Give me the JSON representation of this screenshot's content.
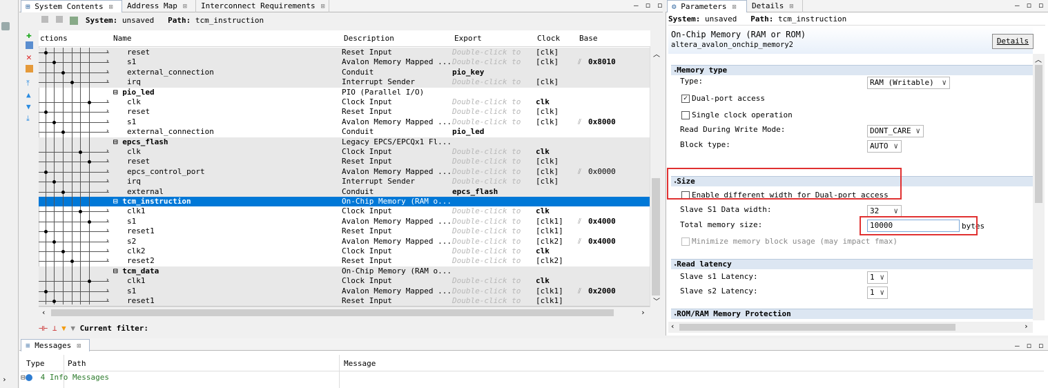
{
  "left_tabs": [
    "System Contents",
    "Address Map",
    "Interconnect Requirements"
  ],
  "right_tabs": [
    "Parameters",
    "Details"
  ],
  "win_ctl": "– ◻ ◻",
  "system_bar": {
    "label": "System:",
    "value": "unsaved",
    "path_label": "Path:",
    "path": "tcm_instruction"
  },
  "columns": {
    "connections": "ctions",
    "name": "Name",
    "description": "Description",
    "export": "Export",
    "clock": "Clock",
    "base": "Base"
  },
  "double_click": "Double-click to",
  "rows": [
    {
      "name": "reset",
      "desc": "Reset Input",
      "export": "",
      "clock": "[clk]",
      "base": ""
    },
    {
      "name": "s1",
      "desc": "Avalon Memory Mapped ...",
      "export": "",
      "clock": "[clk]",
      "base": "0x8010"
    },
    {
      "name": "external_connection",
      "desc": "Conduit",
      "export": "pio_key",
      "clock": "",
      "base": ""
    },
    {
      "name": "irq",
      "desc": "Interrupt Sender",
      "export": "",
      "clock": "[clk]",
      "base": ""
    },
    {
      "name": "⊟ pio_led",
      "desc": "PIO (Parallel I/O)",
      "export": "",
      "clock": "",
      "base": ""
    },
    {
      "name": "clk",
      "desc": "Clock Input",
      "export": "",
      "clock": "clk",
      "base": ""
    },
    {
      "name": "reset",
      "desc": "Reset Input",
      "export": "",
      "clock": "[clk]",
      "base": ""
    },
    {
      "name": "s1",
      "desc": "Avalon Memory Mapped ...",
      "export": "",
      "clock": "[clk]",
      "base": "0x8000"
    },
    {
      "name": "external_connection",
      "desc": "Conduit",
      "export": "pio_led",
      "clock": "",
      "base": ""
    },
    {
      "name": "⊟ epcs_flash",
      "desc": "Legacy EPCS/EPCQx1 Fl...",
      "export": "",
      "clock": "",
      "base": ""
    },
    {
      "name": "clk",
      "desc": "Clock Input",
      "export": "",
      "clock": "clk",
      "base": ""
    },
    {
      "name": "reset",
      "desc": "Reset Input",
      "export": "",
      "clock": "[clk]",
      "base": ""
    },
    {
      "name": "epcs_control_port",
      "desc": "Avalon Memory Mapped ...",
      "export": "",
      "clock": "[clk]",
      "base": "0x0000"
    },
    {
      "name": "irq",
      "desc": "Interrupt Sender",
      "export": "",
      "clock": "[clk]",
      "base": ""
    },
    {
      "name": "external",
      "desc": "Conduit",
      "export": "epcs_flash",
      "clock": "",
      "base": ""
    },
    {
      "name": "⊟ tcm_instruction",
      "desc": "On-Chip Memory (RAM o...",
      "export": "",
      "clock": "",
      "base": ""
    },
    {
      "name": "clk1",
      "desc": "Clock Input",
      "export": "",
      "clock": "clk",
      "base": ""
    },
    {
      "name": "s1",
      "desc": "Avalon Memory Mapped ...",
      "export": "",
      "clock": "[clk1]",
      "base": "0x4000"
    },
    {
      "name": "reset1",
      "desc": "Reset Input",
      "export": "",
      "clock": "[clk1]",
      "base": ""
    },
    {
      "name": "s2",
      "desc": "Avalon Memory Mapped ...",
      "export": "",
      "clock": "[clk2]",
      "base": "0x4000"
    },
    {
      "name": "clk2",
      "desc": "Clock Input",
      "export": "",
      "clock": "clk",
      "base": ""
    },
    {
      "name": "reset2",
      "desc": "Reset Input",
      "export": "",
      "clock": "[clk2]",
      "base": ""
    },
    {
      "name": "⊟ tcm_data",
      "desc": "On-Chip Memory (RAM o...",
      "export": "",
      "clock": "",
      "base": ""
    },
    {
      "name": "clk1",
      "desc": "Clock Input",
      "export": "",
      "clock": "clk",
      "base": ""
    },
    {
      "name": "s1",
      "desc": "Avalon Memory Mapped ...",
      "export": "",
      "clock": "[clk1]",
      "base": "0x2000"
    },
    {
      "name": "reset1",
      "desc": "Reset Input",
      "export": "",
      "clock": "[clk1]",
      "base": ""
    }
  ],
  "filter_label": "Current filter:",
  "params": {
    "system_label": "System:",
    "system_value": "unsaved",
    "path_label": "Path:",
    "path": "tcm_instruction",
    "component_title": "On-Chip Memory (RAM or ROM)",
    "component_id": "altera_avalon_onchip_memory2",
    "details_button": "Details",
    "memory_type": "Memory type",
    "type_label": "Type:",
    "type_value": "RAM (Writable)",
    "dual_port": "Dual-port access",
    "single_clock": "Single clock operation",
    "rdw_label": "Read During Write Mode:",
    "rdw_value": "DONT_CARE",
    "block_label": "Block type:",
    "block_value": "AUTO",
    "size": "Size",
    "diff_width": "Enable different width for Dual-port access",
    "data_width_label": "Slave S1 Data width:",
    "data_width_value": "32",
    "total_mem_label": "Total memory size:",
    "total_mem_value": "10000",
    "bytes": "bytes",
    "minimize": "Minimize memory block usage (may impact fmax)",
    "read_latency": "Read latency",
    "s1_latency_label": "Slave s1 Latency:",
    "s1_latency": "1",
    "s2_latency_label": "Slave s2 Latency:",
    "s2_latency": "1",
    "protection": "ROM/RAM Memory Protection"
  },
  "messages": {
    "tab": "Messages",
    "col_type": "Type",
    "col_path": "Path",
    "col_message": "Message",
    "info": "4 Info Messages"
  }
}
